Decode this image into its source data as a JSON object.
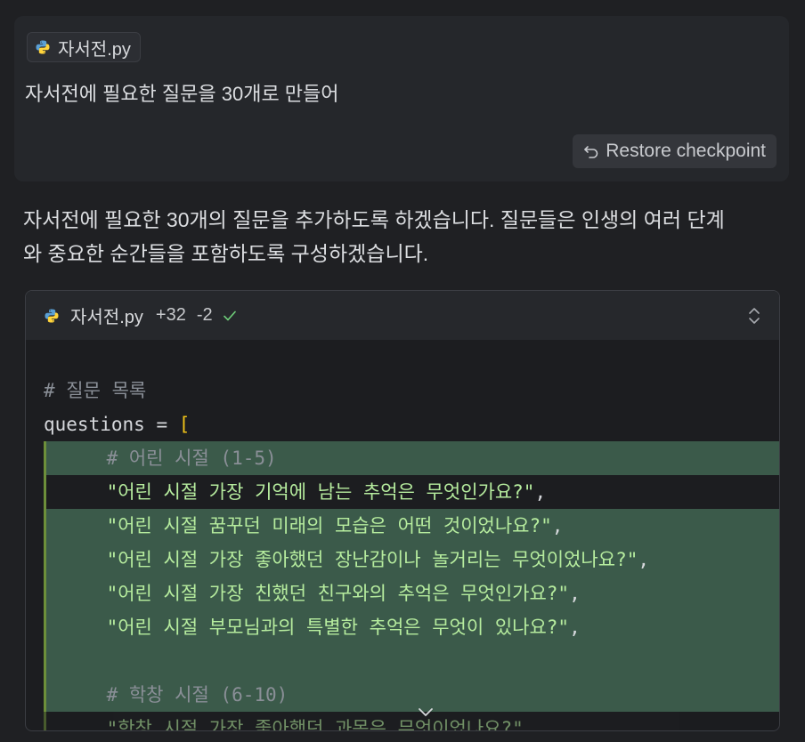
{
  "user_message": {
    "attachment_filename": "자서전.py",
    "text": "자서전에 필요한 질문을 30개로 만들어",
    "restore_label": "Restore checkpoint"
  },
  "assistant": {
    "line1": "자서전에 필요한 30개의 질문을 추가하도록 하겠습니다. 질문들은 인생의 여러 단계",
    "line2": "와 중요한 순간들을 포함하도록 구성하겠습니다."
  },
  "diff": {
    "filename": "자서전.py",
    "added": "+32",
    "removed": "-2",
    "lines": [
      {
        "text": "",
        "kind": "context"
      },
      {
        "text": "# 질문 목록",
        "kind": "comment"
      },
      {
        "ident": "questions",
        "op": " = ",
        "bracket": "[",
        "kind": "assign"
      },
      {
        "text": "    # 어린 시절 (1-5)",
        "kind": "added-comment"
      },
      {
        "text": "    \"어린 시절 가장 기억에 남는 추억은 무엇인가요?\"",
        "trail": ",",
        "kind": "added-plain"
      },
      {
        "text": "    \"어린 시절 꿈꾸던 미래의 모습은 어떤 것이었나요?\"",
        "trail": ",",
        "kind": "added"
      },
      {
        "text": "    \"어린 시절 가장 좋아했던 장난감이나 놀거리는 무엇이었나요?\"",
        "trail": ",",
        "kind": "added"
      },
      {
        "text": "    \"어린 시절 가장 친했던 친구와의 추억은 무엇인가요?\"",
        "trail": ",",
        "kind": "added"
      },
      {
        "text": "    \"어린 시절 부모님과의 특별한 추억은 무엇이 있나요?\"",
        "trail": ",",
        "kind": "added"
      },
      {
        "text": "",
        "kind": "added-empty"
      },
      {
        "text": "    # 학창 시절 (6-10)",
        "kind": "added-comment"
      },
      {
        "text": "    \"학창 시절 가장 좋아했던 과목은 무엇이었나요?\"",
        "trail": ",",
        "kind": "added-faded"
      }
    ]
  },
  "colors": {
    "background": "#1f2023",
    "added_bg": "#3b5a4a",
    "string": "#b6ec9e",
    "bracket": "#f2c418",
    "comment": "#8a8f97"
  }
}
